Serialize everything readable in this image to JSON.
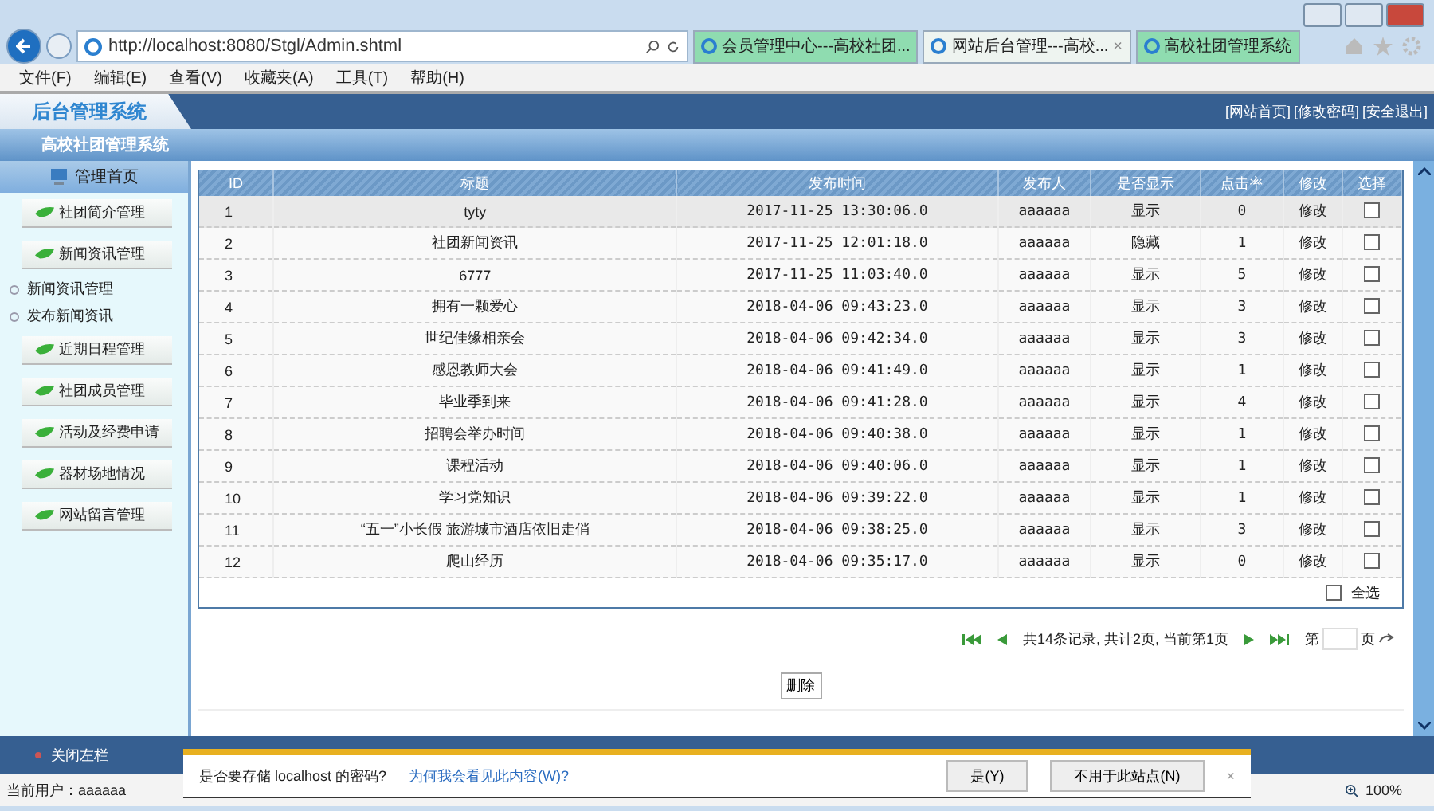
{
  "browser": {
    "address": "http://localhost:8080/Stgl/Admin.shtml",
    "tabs": [
      {
        "label": "会员管理中心---高校社团...",
        "selected": false
      },
      {
        "label": "网站后台管理---高校...",
        "selected": true,
        "close": "×"
      },
      {
        "label": "高校社团管理系统",
        "selected": false
      }
    ],
    "menu": [
      "文件(F)",
      "编辑(E)",
      "查看(V)",
      "收藏夹(A)",
      "工具(T)",
      "帮助(H)"
    ]
  },
  "header": {
    "title": "后台管理系统",
    "links": [
      "[网站首页]",
      "[修改密码]",
      "[安全退出]"
    ],
    "subtitle": "高校社团管理系统"
  },
  "sidebar": {
    "home": "管理首页",
    "groups": [
      {
        "label": "社团简介管理"
      },
      {
        "label": "新闻资讯管理",
        "children": [
          {
            "label": "新闻资讯管理"
          },
          {
            "label": "发布新闻资讯"
          }
        ]
      },
      {
        "label": "近期日程管理"
      },
      {
        "label": "社团成员管理"
      },
      {
        "label": "活动及经费申请"
      },
      {
        "label": "器材场地情况"
      },
      {
        "label": "网站留言管理"
      }
    ],
    "close": "关闭左栏"
  },
  "table": {
    "columns": [
      "ID",
      "标题",
      "发布时间",
      "发布人",
      "是否显示",
      "点击率",
      "修改",
      "选择"
    ],
    "rows": [
      {
        "id": "1",
        "title": "tyty",
        "time": "2017-11-25 13:30:06.0",
        "author": "aaaaaa",
        "display": "显示",
        "clicks": "0",
        "edit": "修改",
        "checked": false,
        "selected": true
      },
      {
        "id": "2",
        "title": "社团新闻资讯",
        "time": "2017-11-25 12:01:18.0",
        "author": "aaaaaa",
        "display": "隐藏",
        "clicks": "1",
        "edit": "修改",
        "checked": false,
        "selected": false
      },
      {
        "id": "3",
        "title": "6777",
        "time": "2017-11-25 11:03:40.0",
        "author": "aaaaaa",
        "display": "显示",
        "clicks": "5",
        "edit": "修改",
        "checked": false,
        "selected": false
      },
      {
        "id": "4",
        "title": "拥有一颗爱心",
        "time": "2018-04-06 09:43:23.0",
        "author": "aaaaaa",
        "display": "显示",
        "clicks": "3",
        "edit": "修改",
        "checked": false,
        "selected": false
      },
      {
        "id": "5",
        "title": "世纪佳缘相亲会",
        "time": "2018-04-06 09:42:34.0",
        "author": "aaaaaa",
        "display": "显示",
        "clicks": "3",
        "edit": "修改",
        "checked": false,
        "selected": false
      },
      {
        "id": "6",
        "title": "感恩教师大会",
        "time": "2018-04-06 09:41:49.0",
        "author": "aaaaaa",
        "display": "显示",
        "clicks": "1",
        "edit": "修改",
        "checked": false,
        "selected": false
      },
      {
        "id": "7",
        "title": "毕业季到来",
        "time": "2018-04-06 09:41:28.0",
        "author": "aaaaaa",
        "display": "显示",
        "clicks": "4",
        "edit": "修改",
        "checked": false,
        "selected": false
      },
      {
        "id": "8",
        "title": "招聘会举办时间",
        "time": "2018-04-06 09:40:38.0",
        "author": "aaaaaa",
        "display": "显示",
        "clicks": "1",
        "edit": "修改",
        "checked": false,
        "selected": false
      },
      {
        "id": "9",
        "title": "课程活动",
        "time": "2018-04-06 09:40:06.0",
        "author": "aaaaaa",
        "display": "显示",
        "clicks": "1",
        "edit": "修改",
        "checked": false,
        "selected": false
      },
      {
        "id": "10",
        "title": "学习党知识",
        "time": "2018-04-06 09:39:22.0",
        "author": "aaaaaa",
        "display": "显示",
        "clicks": "1",
        "edit": "修改",
        "checked": false,
        "selected": false
      },
      {
        "id": "11",
        "title": "“五一”小长假 旅游城市酒店依旧走俏",
        "time": "2018-04-06 09:38:25.0",
        "author": "aaaaaa",
        "display": "显示",
        "clicks": "3",
        "edit": "修改",
        "checked": false,
        "selected": false
      },
      {
        "id": "12",
        "title": "爬山经历",
        "time": "2018-04-06 09:35:17.0",
        "author": "aaaaaa",
        "display": "显示",
        "clicks": "0",
        "edit": "修改",
        "checked": false,
        "selected": false
      }
    ],
    "select_all": {
      "label": "全选",
      "checked": false
    }
  },
  "pagination": {
    "summary": "共14条记录, 共计2页, 当前第1页",
    "page_prefix": "第",
    "page_suffix": "页"
  },
  "delete_button": "删除",
  "status": {
    "user": "当前用户：aaaaaa",
    "zoom": "100%"
  },
  "notification": {
    "message": "是否要存储 localhost 的密码?",
    "link": "为何我会看见此内容(W)?",
    "buttons": [
      "是(Y)",
      "不用于此站点(N)"
    ],
    "close": "×"
  }
}
